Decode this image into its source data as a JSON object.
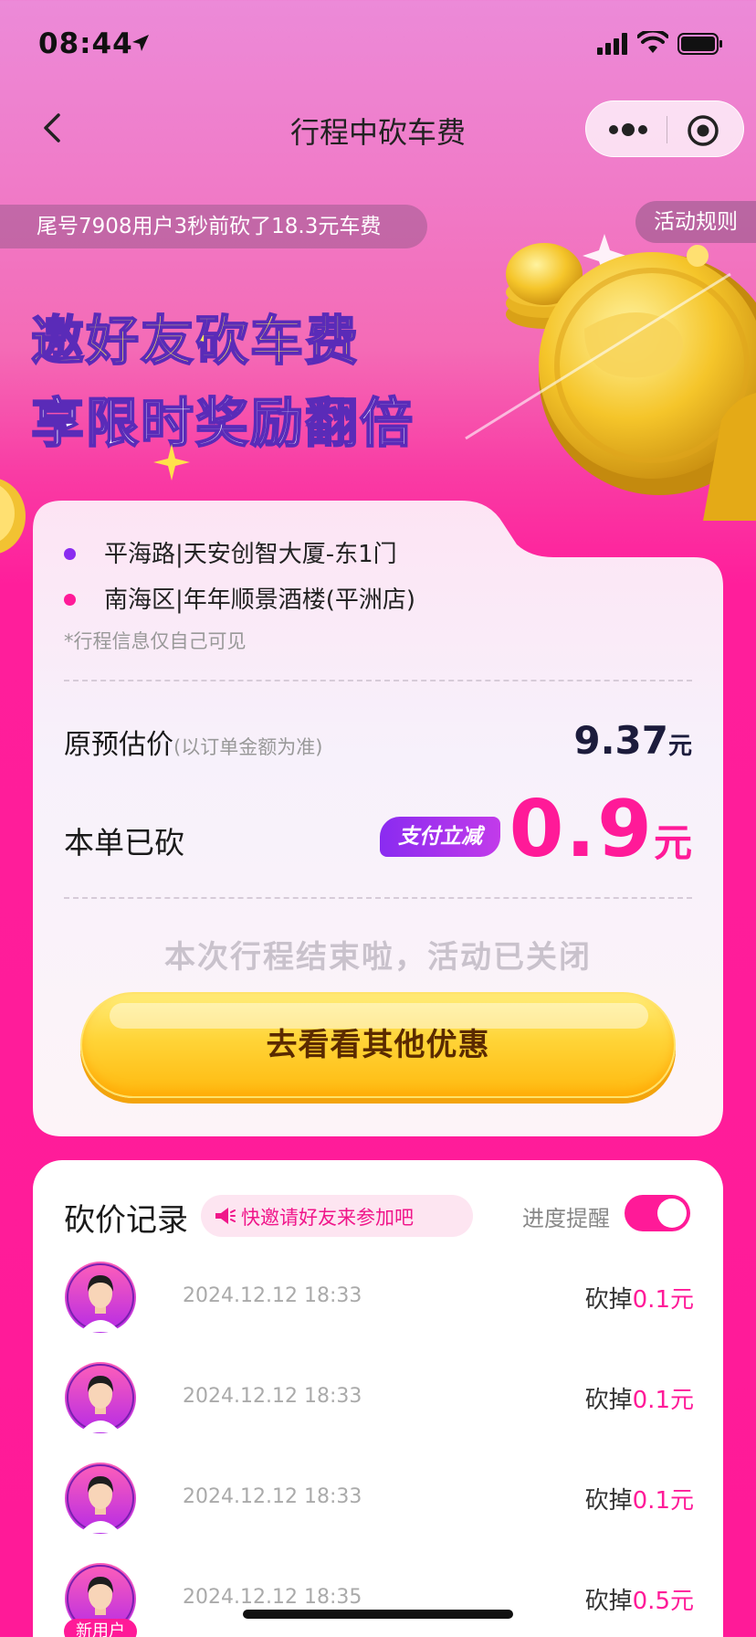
{
  "status_bar": {
    "time": "08:44"
  },
  "nav": {
    "title": "行程中砍车费"
  },
  "ticker": {
    "text": "尾号7908用户3秒前砍了18.3元车费",
    "rules_label": "活动规则"
  },
  "banner": {
    "line1": "邀好友砍车费",
    "line2": "享限时奖励翻倍"
  },
  "trip": {
    "from": "平海路|天安创智大厦-东1门",
    "to": "南海区|年年顺景酒楼(平洲店)",
    "note": "*行程信息仅自己可见",
    "estimate_label": "原预估价",
    "estimate_note": "(以订单金额为准)",
    "estimate_value": "9.37",
    "estimate_unit": "元",
    "cut_label": "本单已砍",
    "pay_badge": "支付立减",
    "cut_value": "0.9",
    "cut_unit": "元",
    "closed_text": "本次行程结束啦，活动已关闭",
    "cta_label": "去看看其他优惠"
  },
  "records": {
    "title": "砍价记录",
    "invite_text": "快邀请好友来参加吧",
    "remind_label": "进度提醒",
    "remind_on": true,
    "items": [
      {
        "time": "2024.12.12 18:33",
        "prefix": "砍掉",
        "amount": "0.1元",
        "badge": ""
      },
      {
        "time": "2024.12.12 18:33",
        "prefix": "砍掉",
        "amount": "0.1元",
        "badge": ""
      },
      {
        "time": "2024.12.12 18:33",
        "prefix": "砍掉",
        "amount": "0.1元",
        "badge": ""
      },
      {
        "time": "2024.12.12 18:35",
        "prefix": "砍掉",
        "amount": "0.5元",
        "badge": "新用户"
      }
    ]
  },
  "colors": {
    "accent": "#ff1a98",
    "purple": "#8a2bf0",
    "gold": "#ffd437"
  }
}
